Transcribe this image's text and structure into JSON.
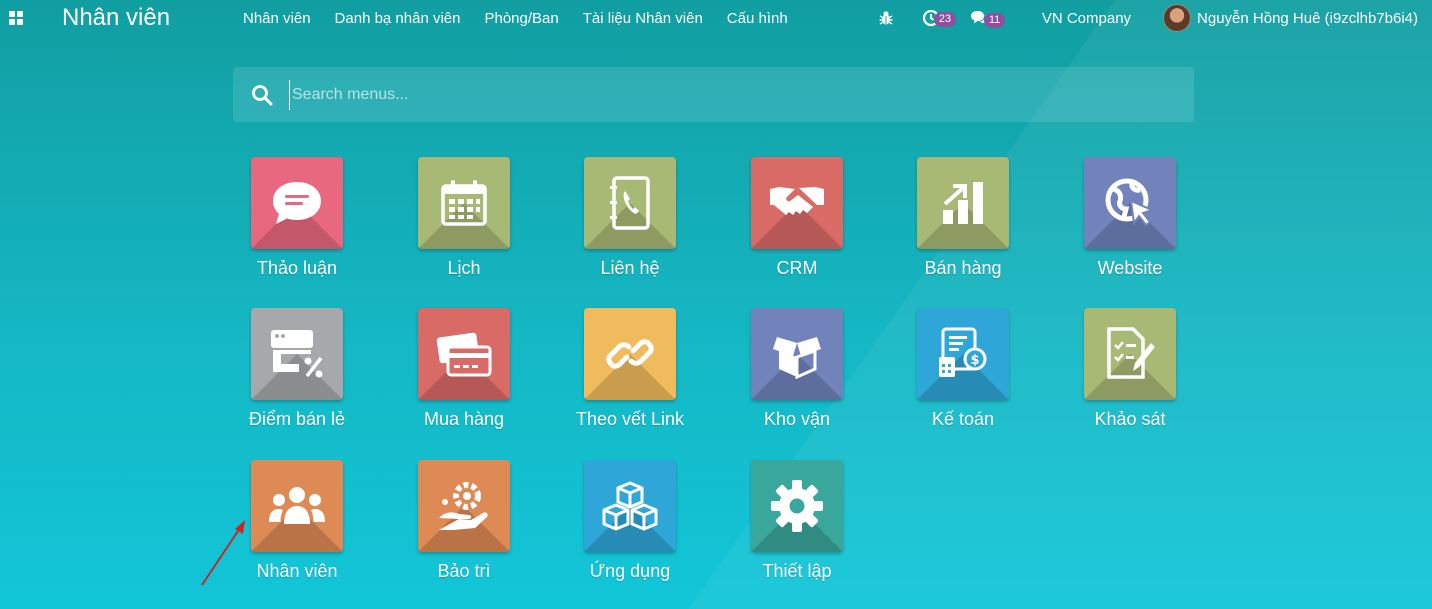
{
  "navbar": {
    "brand": "Nhân viên",
    "menu": [
      "Nhân viên",
      "Danh bạ nhân viên",
      "Phòng/Ban",
      "Tài liệu Nhân viên",
      "Cấu hình"
    ],
    "activity_count": "23",
    "message_count": "11",
    "company": "VN Company",
    "user": "Nguyễn Hồng Huê (i9zclhb7b6i4)"
  },
  "search": {
    "placeholder": "Search menus..."
  },
  "apps": [
    {
      "label": "Thảo luận",
      "icon": "chat-icon",
      "color": "#e8697f"
    },
    {
      "label": "Lịch",
      "icon": "calendar-icon",
      "color": "#a8b976"
    },
    {
      "label": "Liên hệ",
      "icon": "address-book-icon",
      "color": "#a8b976"
    },
    {
      "label": "CRM",
      "icon": "handshake-icon",
      "color": "#d96b67"
    },
    {
      "label": "Bán hàng",
      "icon": "sales-chart-icon",
      "color": "#a8b976"
    },
    {
      "label": "Website",
      "icon": "globe-cursor-icon",
      "color": "#7183ba"
    },
    {
      "label": "Điểm bán lẻ",
      "icon": "shop-icon",
      "color": "#a6a8ab"
    },
    {
      "label": "Mua hàng",
      "icon": "credit-card-icon",
      "color": "#d96b67"
    },
    {
      "label": "Theo vết Link",
      "icon": "link-icon",
      "color": "#f0bb5c"
    },
    {
      "label": "Kho vận",
      "icon": "box-icon",
      "color": "#7183ba"
    },
    {
      "label": "Kế toán",
      "icon": "accounting-icon",
      "color": "#2ea7d8"
    },
    {
      "label": "Khảo sát",
      "icon": "survey-icon",
      "color": "#a8b976"
    },
    {
      "label": "Nhân viên",
      "icon": "users-icon",
      "color": "#dd8a55"
    },
    {
      "label": "Bảo trì",
      "icon": "maintenance-icon",
      "color": "#dd8a55"
    },
    {
      "label": "Ứng dụng",
      "icon": "cubes-icon",
      "color": "#2ea7d8"
    },
    {
      "label": "Thiết lập",
      "icon": "gear-icon",
      "color": "#3aa79c"
    }
  ]
}
